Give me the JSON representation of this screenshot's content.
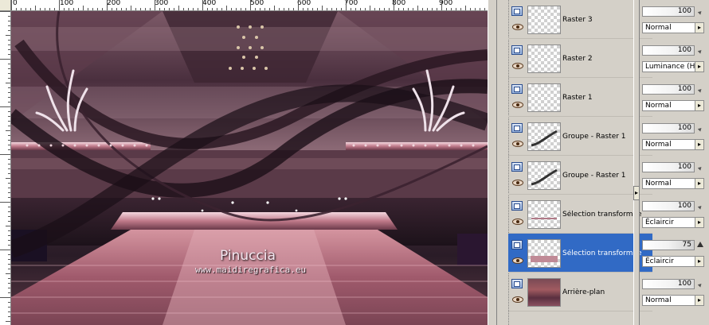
{
  "ruler": {
    "horizontal_labels": [
      "0",
      "100",
      "200",
      "300",
      "400",
      "500",
      "600",
      "700",
      "800",
      "900"
    ]
  },
  "watermark": {
    "title": "Pinuccia",
    "url": "www.maidiregrafica.eu"
  },
  "layers": [
    {
      "name": "Raster 3",
      "opacity": "100",
      "blend": "Normal",
      "thumb": "transparent",
      "selected": false
    },
    {
      "name": "Raster 2",
      "opacity": "100",
      "blend": "Luminance (H)",
      "thumb": "transparent",
      "selected": false
    },
    {
      "name": "Raster 1",
      "opacity": "100",
      "blend": "Normal",
      "thumb": "transparent",
      "selected": false
    },
    {
      "name": "Groupe - Raster 1",
      "opacity": "100",
      "blend": "Normal",
      "thumb": "stroke",
      "selected": false
    },
    {
      "name": "Groupe - Raster 1",
      "opacity": "100",
      "blend": "Normal",
      "thumb": "stroke",
      "selected": false
    },
    {
      "name": "Sélection transformée",
      "opacity": "100",
      "blend": "Éclaircir",
      "thumb": "line",
      "selected": false
    },
    {
      "name": "Sélection transformée",
      "opacity": "75",
      "blend": "Éclaircir",
      "thumb": "band",
      "selected": true
    },
    {
      "name": "Arrière-plan",
      "opacity": "100",
      "blend": "Normal",
      "thumb": "background",
      "selected": false
    }
  ],
  "colors": {
    "selection": "#316ac5",
    "canvas_dark": "#2a1c27",
    "canvas_rose": "#c98a98"
  },
  "icons": {
    "layer_type": "raster-layer-icon",
    "visibility": "eye-icon",
    "expand": "chevron-right-icon"
  }
}
